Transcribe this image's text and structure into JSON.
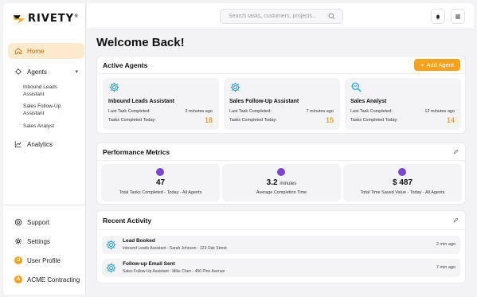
{
  "app": {
    "logo_text": "RIVETY",
    "logo_tm": "®"
  },
  "sidebar": {
    "items": [
      {
        "label": "Home"
      },
      {
        "label": "Agents"
      },
      {
        "label": "Analytics"
      }
    ],
    "agent_subitems": [
      "Inbound Leads Assistant",
      "Sales Follow-Up Assistant",
      "Sales Analyst"
    ],
    "bottom": [
      {
        "label": "Support"
      },
      {
        "label": "Settings"
      },
      {
        "label": "User Profile",
        "initial": "U"
      },
      {
        "label": "ACME Contracting",
        "initial": "A"
      }
    ]
  },
  "topbar": {
    "search_placeholder": "Search tasks, customers, projects..."
  },
  "main": {
    "welcome": "Welcome Back!",
    "active_agents": {
      "title": "Active Agents",
      "add_label": "Add Agent",
      "agents": [
        {
          "name": "Inbound Leads Assistant",
          "last_label": "Last Task Completed:",
          "last_value": "2 minutes ago",
          "today_label": "Tasks Completed Today:",
          "today_value": "18",
          "icon": "gear-icon"
        },
        {
          "name": "Sales Follow-Up Assistant",
          "last_label": "Last Task Completed:",
          "last_value": "7 minutes ago",
          "today_label": "Tasks Completed Today:",
          "today_value": "15",
          "icon": "gear-icon"
        },
        {
          "name": "Sales Analyst",
          "last_label": "Last Task Completed:",
          "last_value": "12 minutes ago",
          "today_label": "Tasks Completed Today:",
          "today_value": "14",
          "icon": "magnifier-icon"
        }
      ]
    },
    "metrics": {
      "title": "Performance Metrics",
      "items": [
        {
          "value": "47",
          "unit": "",
          "label": "Total Tasks Completed - Today - All Agents"
        },
        {
          "value": "3.2",
          "unit": "minutes",
          "label": "Average Completion Time"
        },
        {
          "value": "$ 487",
          "unit": "",
          "label": "Total Time Saved Value - Today - All Agents"
        }
      ]
    },
    "activity": {
      "title": "Recent Activity",
      "items": [
        {
          "title": "Lead Booked",
          "subtitle": "Inbound Leads Assistant - Sarah Johnson - 123 Oak Street",
          "time": "2 min ago"
        },
        {
          "title": "Follow-up Email Sent",
          "subtitle": "Sales Follow-Up Assistant - Mike Chen - 456 Pine Avenue",
          "time": "7 min ago"
        }
      ]
    }
  },
  "colors": {
    "accent": "#f5a21a",
    "accent_light": "#fdeacd",
    "gear": "#29a8dc",
    "metric_icon": "#7b45d6"
  }
}
